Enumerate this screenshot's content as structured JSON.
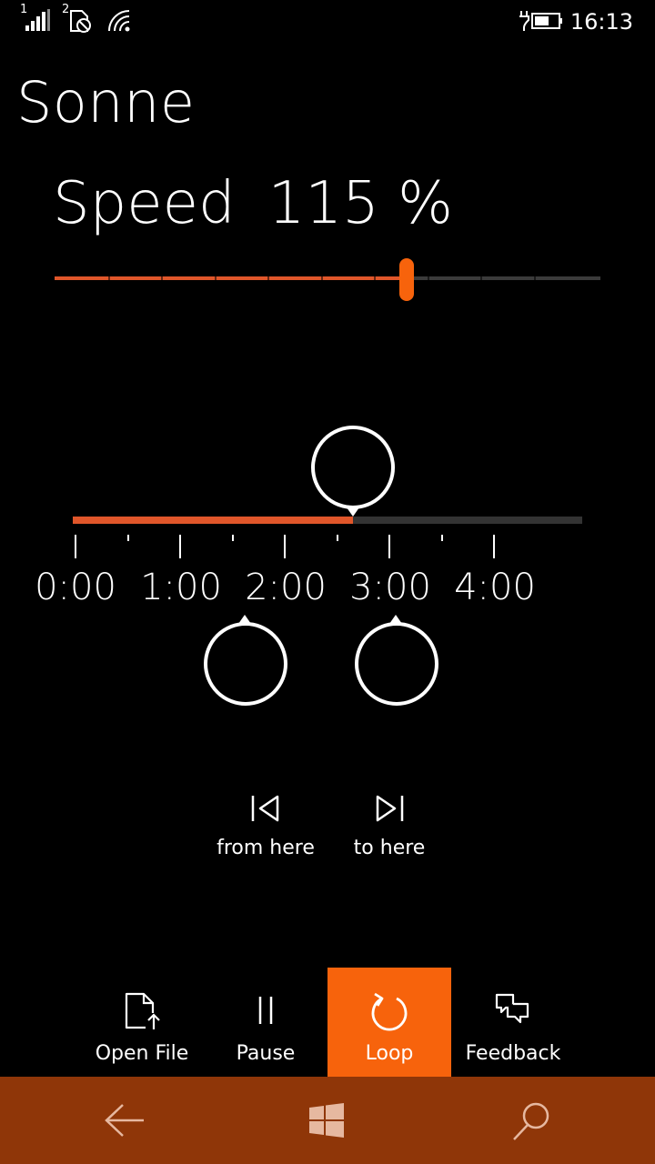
{
  "status": {
    "sim1_label": "1",
    "sim2_label": "2",
    "time": "16:13"
  },
  "app": {
    "title": "Sonne",
    "speed_label": "Speed",
    "speed_value": "115 %",
    "speed_fraction": 0.645,
    "position_fraction": 0.55
  },
  "timeline": {
    "labels": [
      "0:00",
      "1:00",
      "2:00",
      "3:00",
      "4:00"
    ]
  },
  "loop_controls": {
    "from_label": "from here",
    "to_label": "to here"
  },
  "app_bar": {
    "open_file": "Open File",
    "pause": "Pause",
    "loop": "Loop",
    "feedback": "Feedback"
  },
  "colors": {
    "accent": "#f7630c",
    "track_fill": "#e0562a",
    "nav_bar": "#8f3608",
    "background": "#000000"
  },
  "icons": {
    "signal": "signal-strength-icon",
    "sim2": "sim-no-service-icon",
    "wifi": "wifi-icon",
    "battery": "battery-charging-icon",
    "from_here": "skip-to-start-icon",
    "to_here": "skip-to-end-icon",
    "open_file": "open-file-icon",
    "pause": "pause-icon",
    "loop": "loop-icon",
    "feedback": "feedback-icon",
    "back": "back-arrow-icon",
    "windows": "windows-logo-icon",
    "search": "search-icon"
  }
}
